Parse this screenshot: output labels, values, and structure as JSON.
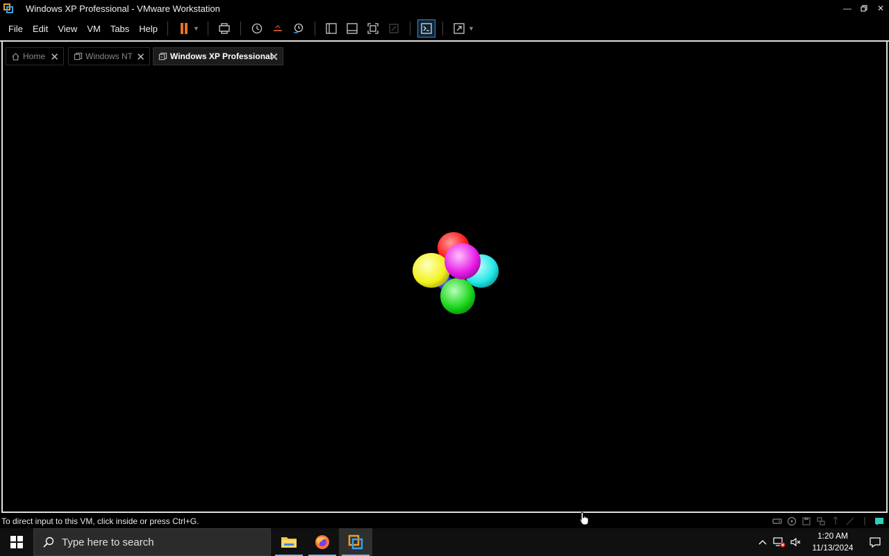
{
  "window": {
    "title": "Windows XP Professional - VMware Workstation"
  },
  "menu": [
    "File",
    "Edit",
    "View",
    "VM",
    "Tabs",
    "Help"
  ],
  "tabs": [
    {
      "label": "Home",
      "icon": "home-icon",
      "active": false
    },
    {
      "label": "Windows NT",
      "icon": "vm-icon",
      "active": false
    },
    {
      "label": "Windows XP Professional",
      "icon": "vm-running-icon",
      "active": true
    }
  ],
  "statusbar": {
    "message": "To direct input to this VM, click inside or press Ctrl+G."
  },
  "taskbar": {
    "search_placeholder": "Type here to search",
    "time": "1:20 AM",
    "date": "11/13/2024"
  },
  "colors": {
    "pause_accent": "#e8702a",
    "vmware_orange": "#f0a020",
    "vmware_blue": "#3aa0e8",
    "sphere_red": "#ff1a1a",
    "sphere_yellow": "#f2f21c",
    "sphere_cyan": "#22e6e6",
    "sphere_green": "#19d419",
    "sphere_magenta": "#e61ae6",
    "sphere_blue": "#1a1ae6"
  }
}
